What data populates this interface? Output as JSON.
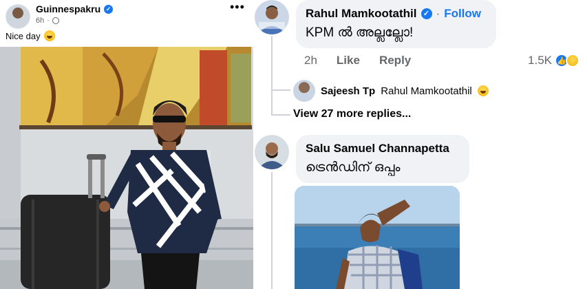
{
  "post": {
    "author": "Guinnespakru",
    "time": "6h",
    "dot": "·",
    "more_label": "•••",
    "caption": "Nice day"
  },
  "comments": [
    {
      "author": "Rahul Mamkootathil",
      "separator": "·",
      "follow_label": "Follow",
      "text": "KPM ൽ അല്ലല്ലോ!",
      "time": "2h",
      "like_label": "Like",
      "reply_label": "Reply",
      "reaction_count": "1.5K"
    },
    {
      "author": "Salu Samuel Channapetta",
      "text": "ട്രെൻഡിന് ഒപ്പം"
    }
  ],
  "reply": {
    "author": "Sajeesh Tp",
    "tag": "Rahul Mamkootathil"
  },
  "view_more_label": "View 27 more replies...",
  "colors": {
    "accent": "#1877f2",
    "bubble": "#f0f2f5",
    "secondary_text": "#65676b"
  }
}
